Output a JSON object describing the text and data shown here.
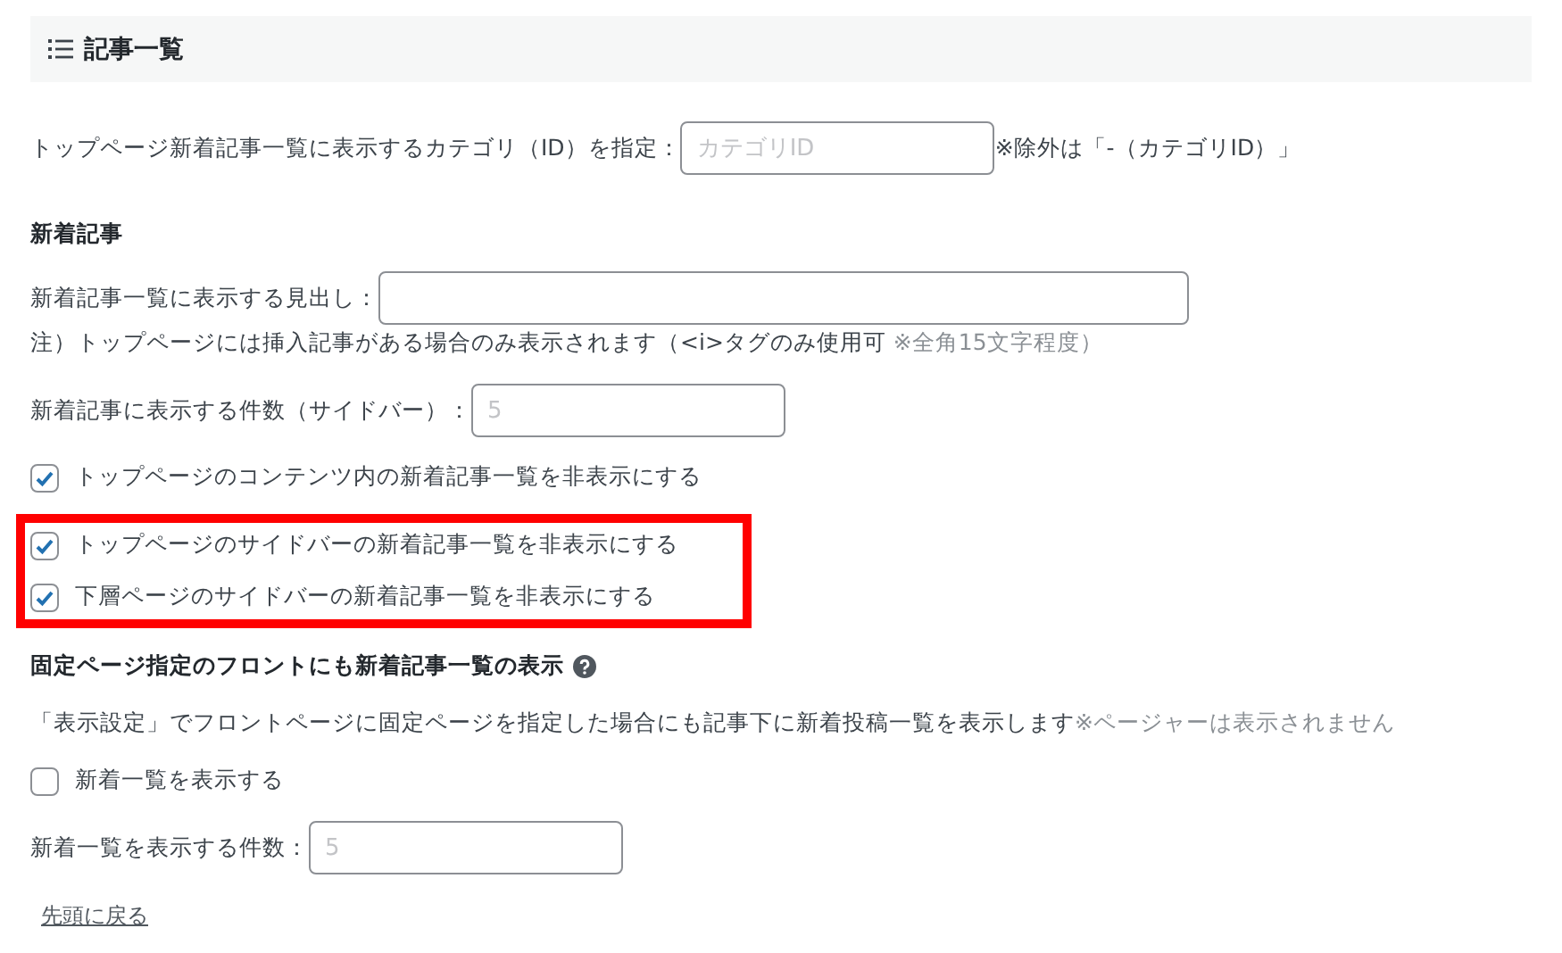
{
  "section": {
    "title": "記事一覧"
  },
  "category_row": {
    "label": "トップページ新着記事一覧に表示するカテゴリ（ID）を指定：",
    "placeholder": "カテゴリID",
    "note": "※除外は「-（カテゴリID）」"
  },
  "new_posts": {
    "title": "新着記事",
    "heading_row": {
      "label": "新着記事一覧に表示する見出し："
    },
    "heading_note": {
      "text": "注）トップページには挿入記事がある場合のみ表示されます（<i>タグのみ使用可 ",
      "hint": "※全角15文字程度）"
    },
    "count_row": {
      "label": "新着記事に表示する件数（サイドバー）：",
      "placeholder": "5"
    },
    "checkboxes": [
      {
        "label": "トップページのコンテンツ内の新着記事一覧を非表示にする",
        "checked": true,
        "highlighted": false
      },
      {
        "label": "トップページのサイドバーの新着記事一覧を非表示にする",
        "checked": true,
        "highlighted": true
      },
      {
        "label": "下層ページのサイドバーの新着記事一覧を非表示にする",
        "checked": true,
        "highlighted": true
      }
    ]
  },
  "front_page": {
    "title": "固定ページ指定のフロントにも新着記事一覧の表示",
    "description": {
      "text": "「表示設定」でフロントページに固定ページを指定した場合にも記事下に新着投稿一覧を表示します",
      "hint": "※ページャーは表示されません"
    },
    "checkboxes": [
      {
        "label": "新着一覧を表示する",
        "checked": false,
        "highlighted": false
      }
    ],
    "count_row": {
      "label": "新着一覧を表示する件数：",
      "placeholder": "5"
    }
  },
  "back_link": "先頭に戻る"
}
